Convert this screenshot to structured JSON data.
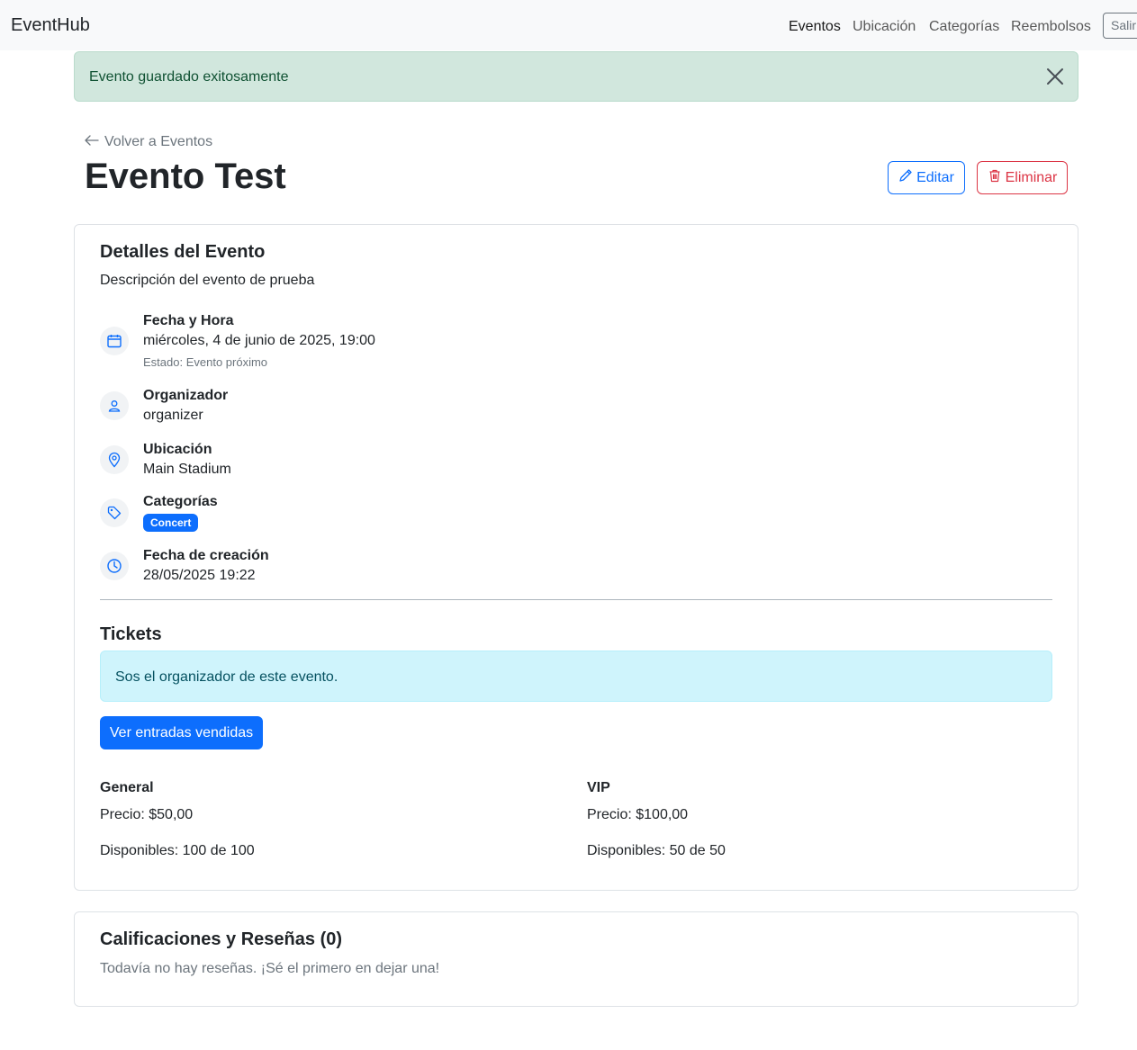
{
  "navbar": {
    "brand": "EventHub",
    "links": [
      "Eventos",
      "Ubicación",
      "Categorías",
      "Reembolsos"
    ],
    "logout": "Salir"
  },
  "alert": {
    "message": "Evento guardado exitosamente"
  },
  "header": {
    "back": "Volver a Eventos",
    "title": "Evento Test",
    "edit": "Editar",
    "delete": "Eliminar"
  },
  "details": {
    "title": "Detalles del Evento",
    "description": "Descripción del evento de prueba",
    "date_label": "Fecha y Hora",
    "date_value": "miércoles, 4 de junio de 2025, 19:00",
    "status": "Estado: Evento próximo",
    "organizer_label": "Organizador",
    "organizer_value": "organizer",
    "location_label": "Ubicación",
    "location_value": "Main Stadium",
    "categories_label": "Categorías",
    "category_badge": "Concert",
    "created_label": "Fecha de creación",
    "created_value": "28/05/2025 19:22"
  },
  "tickets": {
    "title": "Tickets",
    "organizer_notice": "Sos el organizador de este evento.",
    "sold_button": "Ver entradas vendidas",
    "types": [
      {
        "name": "General",
        "price": "Precio: $50,00",
        "available": "Disponibles: 100 de 100"
      },
      {
        "name": "VIP",
        "price": "Precio: $100,00",
        "available": "Disponibles: 50 de 50"
      }
    ]
  },
  "reviews": {
    "title": "Calificaciones y Reseñas (0)",
    "empty": "Todavía no hay reseñas. ¡Sé el primero en dejar una!"
  },
  "colors": {
    "primary": "#0d6efd",
    "danger": "#dc3545",
    "success_bg": "#d1e7dd",
    "info_bg": "#cff4fc"
  }
}
